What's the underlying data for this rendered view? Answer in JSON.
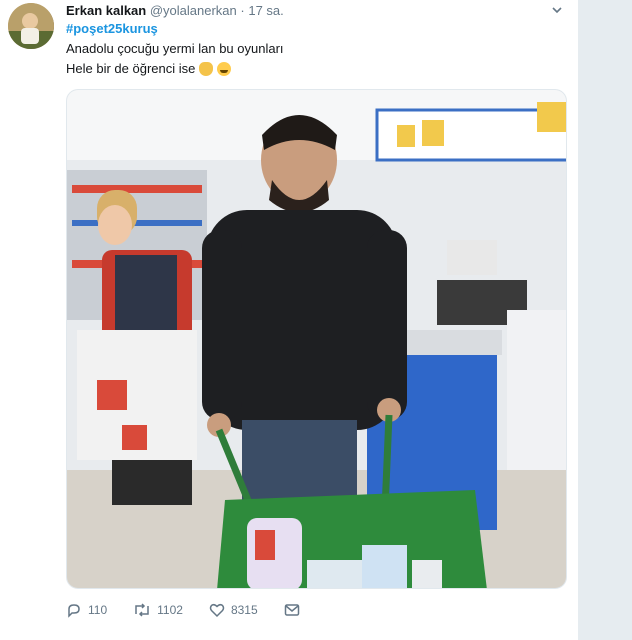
{
  "tweet": {
    "author_name": "Erkan kalkan",
    "handle": "@yolalanerkan",
    "separator": "·",
    "time": "17 sa.",
    "hashtag": "#poşet25kuruş",
    "text_line_1": "Anadolu çocuğu yermi lan bu oyunları",
    "text_line_2": "Hele bir de öğrenci ise"
  },
  "actions": {
    "reply_count": "110",
    "retweet_count": "1102",
    "like_count": "8315"
  },
  "icons": {
    "reply": "reply-icon",
    "retweet": "retweet-icon",
    "like": "heart-icon",
    "message": "envelope-icon",
    "menu": "chevron-down-icon"
  },
  "colors": {
    "link": "#1b95e0",
    "muted": "#657786",
    "text": "#14171a",
    "gutter": "#e6ecf0"
  }
}
